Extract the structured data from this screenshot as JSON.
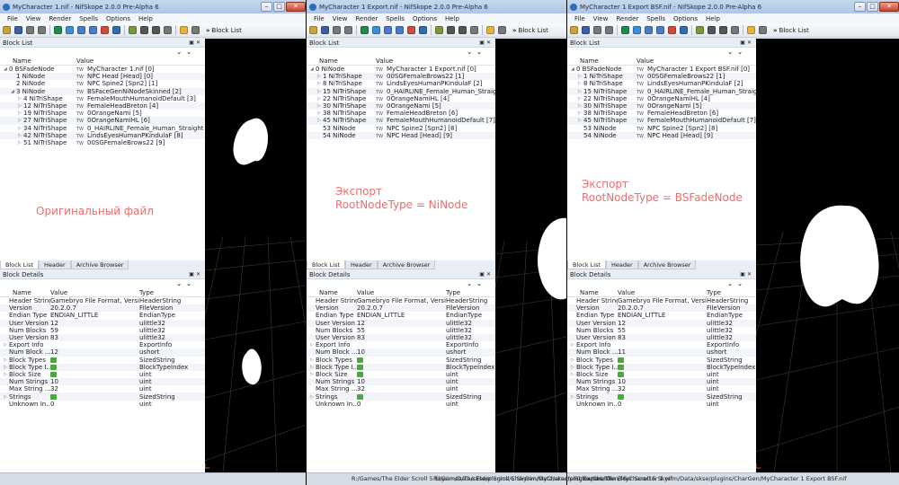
{
  "windows": [
    {
      "title": "MyCharacter 1.nif - NifSkope 2.0.0 Pre-Alpha 6",
      "menu": [
        "File",
        "View",
        "Render",
        "Spells",
        "Options",
        "Help"
      ],
      "toolbar_label": "Block List",
      "block_list": {
        "dock_title": "Block List",
        "col_name": "Name",
        "col_value": "Value",
        "rows": [
          {
            "name": "0 BSFadeNode",
            "value": "MyCharacter 1.nif [0]",
            "level": 0,
            "arrow": "◢"
          },
          {
            "name": "1 NiNode",
            "value": "NPC Head [Head] [0]",
            "level": 1,
            "arrow": ""
          },
          {
            "name": "2 NiNode",
            "value": "NPC Spine2 [Spn2] [1]",
            "level": 1,
            "arrow": ""
          },
          {
            "name": "3 NiNode",
            "value": "BSFaceGenNiNodeSkinned [2]",
            "level": 1,
            "arrow": "◢"
          },
          {
            "name": "4 NiTriShape",
            "value": "FemaleMouthHumanoidDefault [3]",
            "level": 2,
            "arrow": "▷"
          },
          {
            "name": "12 NiTriShape",
            "value": "FemaleHeadBreton [4]",
            "level": 2,
            "arrow": "▷"
          },
          {
            "name": "19 NiTriShape",
            "value": "0OrangeNami [5]",
            "level": 2,
            "arrow": "▷"
          },
          {
            "name": "27 NiTriShape",
            "value": "0OrangeNamiHL [6]",
            "level": 2,
            "arrow": "▷"
          },
          {
            "name": "34 NiTriShape",
            "value": "0_HAIRLINE_Female_Human_Straight [7]",
            "level": 2,
            "arrow": "▷"
          },
          {
            "name": "42 NiTriShape",
            "value": "LindsEyesHumanPKindulaF [8]",
            "level": 2,
            "arrow": "▷"
          },
          {
            "name": "51 NiTriShape",
            "value": "00SGFemaleBrows22 [9]",
            "level": 2,
            "arrow": "▷"
          }
        ]
      },
      "annotation": [
        "Оригинальный файл"
      ],
      "tabs": [
        "Block List",
        "Header",
        "Archive Browser"
      ],
      "block_details": {
        "dock_title": "Block Details",
        "col_name": "Name",
        "col_value": "Value",
        "col_type": "Type",
        "rows": [
          {
            "name": "Header String",
            "value": "Gamebryo File Format, Version 2...",
            "type": "HeaderString",
            "arrow": ""
          },
          {
            "name": "Version",
            "value": "20.2.0.7",
            "type": "FileVersion",
            "arrow": ""
          },
          {
            "name": "Endian Type",
            "value": "ENDIAN_LITTLE",
            "type": "EndianType",
            "arrow": ""
          },
          {
            "name": "User Version",
            "value": "12",
            "type": "ulittle32",
            "arrow": ""
          },
          {
            "name": "Num Blocks",
            "value": "59",
            "type": "ulittle32",
            "arrow": ""
          },
          {
            "name": "User Version 2",
            "value": "83",
            "type": "ulittle32",
            "arrow": ""
          },
          {
            "name": "Export Info",
            "value": "",
            "type": "ExportInfo",
            "arrow": "▷"
          },
          {
            "name": "Num Block ...",
            "value": "12",
            "type": "ushort",
            "arrow": ""
          },
          {
            "name": "Block Types",
            "value": "",
            "type": "SizedString",
            "arrow": "▷",
            "icon": true
          },
          {
            "name": "Block Type I...",
            "value": "",
            "type": "BlockTypeIndex",
            "arrow": "▷",
            "icon": true
          },
          {
            "name": "Block Size",
            "value": "",
            "type": "uint",
            "arrow": "▷",
            "icon": true
          },
          {
            "name": "Num Strings",
            "value": "10",
            "type": "uint",
            "arrow": ""
          },
          {
            "name": "Max String ...",
            "value": "32",
            "type": "uint",
            "arrow": ""
          },
          {
            "name": "Strings",
            "value": "",
            "type": "SizedString",
            "arrow": "▷",
            "icon": true
          },
          {
            "name": "Unknown In...",
            "value": "0",
            "type": "uint",
            "arrow": ""
          }
        ]
      },
      "status_path": ""
    },
    {
      "title": "MyCharacter 1 Export.nif - NifSkope 2.0.0 Pre-Alpha 6",
      "menu": [
        "File",
        "View",
        "Render",
        "Spells",
        "Options",
        "Help"
      ],
      "toolbar_label": "Block List",
      "block_list": {
        "dock_title": "Block List",
        "col_name": "Name",
        "col_value": "Value",
        "rows": [
          {
            "name": "0 NiNode",
            "value": "MyCharacter 1 Export.nif [0]",
            "level": 0,
            "arrow": "◢"
          },
          {
            "name": "1 NiTriShape",
            "value": "00SGFemaleBrows22 [1]",
            "level": 1,
            "arrow": "▷"
          },
          {
            "name": "8 NiTriShape",
            "value": "LindsEyesHumanPKindulaF [2]",
            "level": 1,
            "arrow": "▷"
          },
          {
            "name": "15 NiTriShape",
            "value": "0_HAIRLINE_Female_Human_Straight [3]",
            "level": 1,
            "arrow": "▷"
          },
          {
            "name": "22 NiTriShape",
            "value": "0OrangeNamiHL [4]",
            "level": 1,
            "arrow": "▷"
          },
          {
            "name": "30 NiTriShape",
            "value": "0OrangeNami [5]",
            "level": 1,
            "arrow": "▷"
          },
          {
            "name": "38 NiTriShape",
            "value": "FemaleHeadBreton [6]",
            "level": 1,
            "arrow": "▷"
          },
          {
            "name": "45 NiTriShape",
            "value": "FemaleMouthHumanoidDefault [7]",
            "level": 1,
            "arrow": "▷"
          },
          {
            "name": "53 NiNode",
            "value": "NPC Spine2 [Spn2] [8]",
            "level": 1,
            "arrow": ""
          },
          {
            "name": "54 NiNode",
            "value": "NPC Head [Head] [9]",
            "level": 1,
            "arrow": ""
          }
        ]
      },
      "annotation": [
        "Экспорт",
        "RootNodeType = NiNode"
      ],
      "tabs": [
        "Block List",
        "Header",
        "Archive Browser"
      ],
      "block_details": {
        "dock_title": "Block Details",
        "col_name": "Name",
        "col_value": "Value",
        "col_type": "Type",
        "rows": [
          {
            "name": "Header String",
            "value": "Gamebryo File Format, Version 2...",
            "type": "HeaderString",
            "arrow": ""
          },
          {
            "name": "Version",
            "value": "20.2.0.7",
            "type": "FileVersion",
            "arrow": ""
          },
          {
            "name": "Endian Type",
            "value": "ENDIAN_LITTLE",
            "type": "EndianType",
            "arrow": ""
          },
          {
            "name": "User Version",
            "value": "12",
            "type": "ulittle32",
            "arrow": ""
          },
          {
            "name": "Num Blocks",
            "value": "55",
            "type": "ulittle32",
            "arrow": ""
          },
          {
            "name": "User Version 2",
            "value": "83",
            "type": "ulittle32",
            "arrow": ""
          },
          {
            "name": "Export Info",
            "value": "",
            "type": "ExportInfo",
            "arrow": "▷"
          },
          {
            "name": "Num Block ...",
            "value": "10",
            "type": "ushort",
            "arrow": ""
          },
          {
            "name": "Block Types",
            "value": "",
            "type": "SizedString",
            "arrow": "▷",
            "icon": true
          },
          {
            "name": "Block Type I...",
            "value": "",
            "type": "BlockTypeIndex",
            "arrow": "▷",
            "icon": true
          },
          {
            "name": "Block Size",
            "value": "",
            "type": "uint",
            "arrow": "▷",
            "icon": true
          },
          {
            "name": "Num Strings",
            "value": "10",
            "type": "uint",
            "arrow": ""
          },
          {
            "name": "Max String ...",
            "value": "32",
            "type": "uint",
            "arrow": ""
          },
          {
            "name": "Strings",
            "value": "",
            "type": "SizedString",
            "arrow": "▷",
            "icon": true
          },
          {
            "name": "Unknown In...",
            "value": "0",
            "type": "uint",
            "arrow": ""
          }
        ]
      },
      "status_path": ""
    },
    {
      "title": "MyCharacter 1 Export BSF.nif - NifSkope 2.0.0 Pre-Alpha 6",
      "menu": [
        "File",
        "View",
        "Render",
        "Spells",
        "Options",
        "Help"
      ],
      "toolbar_label": "Block List",
      "block_list": {
        "dock_title": "Block List",
        "col_name": "Name",
        "col_value": "Value",
        "rows": [
          {
            "name": "0 BSFadeNode",
            "value": "MyCharacter 1 Export BSF.nif [0]",
            "level": 0,
            "arrow": "◢"
          },
          {
            "name": "1 NiTriShape",
            "value": "00SGFemaleBrows22 [1]",
            "level": 1,
            "arrow": "▷"
          },
          {
            "name": "8 NiTriShape",
            "value": "LindsEyesHumanPKindulaF [2]",
            "level": 1,
            "arrow": "▷"
          },
          {
            "name": "15 NiTriShape",
            "value": "0_HAIRLINE_Female_Human_Straight [3]",
            "level": 1,
            "arrow": "▷"
          },
          {
            "name": "22 NiTriShape",
            "value": "0OrangeNamiHL [4]",
            "level": 1,
            "arrow": "▷"
          },
          {
            "name": "30 NiTriShape",
            "value": "0OrangeNami [5]",
            "level": 1,
            "arrow": "▷"
          },
          {
            "name": "38 NiTriShape",
            "value": "FemaleHeadBreton [6]",
            "level": 1,
            "arrow": "▷"
          },
          {
            "name": "45 NiTriShape",
            "value": "FemaleMouthHumanoidDefault [7]",
            "level": 1,
            "arrow": "▷"
          },
          {
            "name": "53 NiNode",
            "value": "NPC Spine2 [Spn2] [8]",
            "level": 1,
            "arrow": ""
          },
          {
            "name": "54 NiNode",
            "value": "NPC Head [Head] [9]",
            "level": 1,
            "arrow": ""
          }
        ]
      },
      "annotation": [
        "Экспорт",
        "RootNodeType = BSFadeNode"
      ],
      "tabs": [
        "Block List",
        "Header",
        "Archive Browser"
      ],
      "block_details": {
        "dock_title": "Block Details",
        "col_name": "Name",
        "col_value": "Value",
        "col_type": "Type",
        "rows": [
          {
            "name": "Header String",
            "value": "Gamebryo File Format, Version 2...",
            "type": "HeaderString",
            "arrow": ""
          },
          {
            "name": "Version",
            "value": "20.2.0.7",
            "type": "FileVersion",
            "arrow": ""
          },
          {
            "name": "Endian Type",
            "value": "ENDIAN_LITTLE",
            "type": "EndianType",
            "arrow": ""
          },
          {
            "name": "User Version",
            "value": "12",
            "type": "ulittle32",
            "arrow": ""
          },
          {
            "name": "Num Blocks",
            "value": "55",
            "type": "ulittle32",
            "arrow": ""
          },
          {
            "name": "User Version 2",
            "value": "83",
            "type": "ulittle32",
            "arrow": ""
          },
          {
            "name": "Export Info",
            "value": "",
            "type": "ExportInfo",
            "arrow": "▷"
          },
          {
            "name": "Num Block ...",
            "value": "11",
            "type": "ushort",
            "arrow": ""
          },
          {
            "name": "Block Types",
            "value": "",
            "type": "SizedString",
            "arrow": "▷",
            "icon": true
          },
          {
            "name": "Block Type I...",
            "value": "",
            "type": "BlockTypeIndex",
            "arrow": "▷",
            "icon": true
          },
          {
            "name": "Block Size",
            "value": "",
            "type": "uint",
            "arrow": "▷",
            "icon": true
          },
          {
            "name": "Num Strings",
            "value": "10",
            "type": "uint",
            "arrow": ""
          },
          {
            "name": "Max String ...",
            "value": "32",
            "type": "uint",
            "arrow": ""
          },
          {
            "name": "Strings",
            "value": "",
            "type": "SizedString",
            "arrow": "▷",
            "icon": true
          },
          {
            "name": "Unknown In...",
            "value": "0",
            "type": "uint",
            "arrow": ""
          }
        ]
      },
      "status_path": ""
    }
  ],
  "status_bar": {
    "paths": [
      "R:/Games/The Elder Scroll 5 Skyrim/Data/skse/plugins/CharGen/MyCharacter 1.nif",
      "R:/Games/The Elder Scroll 5 Skyrim/Data/skse/plugins/CharGen/MyCharacter 1 Export.nif",
      "R:/Games/The Elder Scroll 5 Skyrim/Data/skse/plugins/CharGen/MyCharacter 1 Export BSF.nif"
    ]
  },
  "colors": {
    "annotation": "#f26b6b",
    "viewport_bg": "#000000",
    "silhouette": "#ffffff",
    "grid": "#3c3c3c"
  },
  "icons": {
    "window_controls": [
      "minimize-icon",
      "maximize-icon",
      "close-icon"
    ],
    "expand": "triangle-expand-icon",
    "collapsed": "triangle-collapsed-icon",
    "node_type": "tw-icon",
    "array": "green-array-icon"
  }
}
